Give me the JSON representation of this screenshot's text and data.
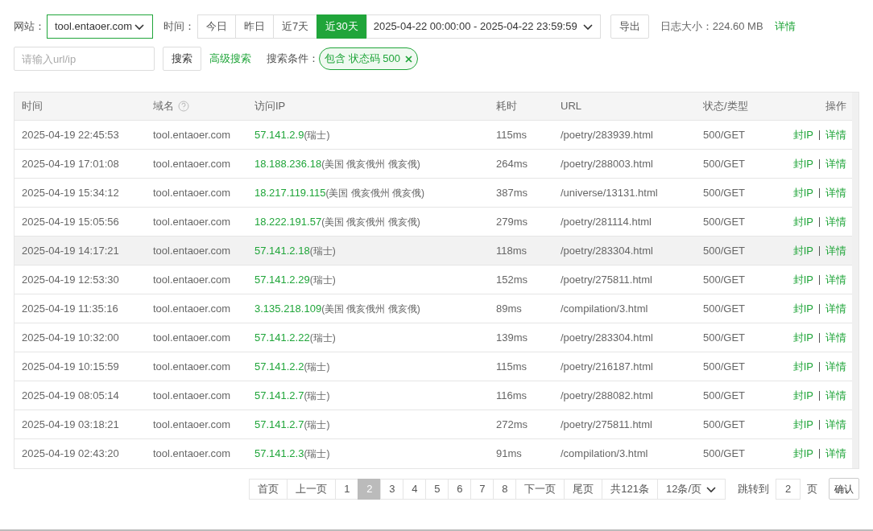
{
  "filters": {
    "site_label": "网站：",
    "site_value": "tool.entaoer.com",
    "time_label": "时间：",
    "ranges": [
      {
        "label": "今日",
        "selected": false
      },
      {
        "label": "昨日",
        "selected": false
      },
      {
        "label": "近7天",
        "selected": false
      },
      {
        "label": "近30天",
        "selected": true
      }
    ],
    "date_range": "2025-04-22 00:00:00 - 2025-04-22 23:59:59",
    "export": "导出",
    "log_size": "日志大小：224.60 MB",
    "details_link": "详情"
  },
  "search": {
    "placeholder": "请输入url/ip",
    "button": "搜索",
    "advanced": "高级搜索",
    "conditions_label": "搜索条件：",
    "tags": [
      "包含 状态码 500"
    ]
  },
  "table": {
    "columns": [
      "时间",
      "域名",
      "访问IP",
      "耗时",
      "URL",
      "状态/类型",
      "操作"
    ],
    "rows": [
      {
        "time": "2025-04-19 22:45:53",
        "domain": "tool.entaoer.com",
        "ip": "57.141.2.9",
        "location": "(瑞士)",
        "duration": "115ms",
        "url": "/poetry/283939.html",
        "status": "500/GET",
        "actions": [
          "封IP",
          "详情"
        ],
        "selected": false
      },
      {
        "time": "2025-04-19 17:01:08",
        "domain": "tool.entaoer.com",
        "ip": "18.188.236.18",
        "location": "(美国 俄亥俄州 俄亥俄)",
        "duration": "264ms",
        "url": "/poetry/288003.html",
        "status": "500/GET",
        "actions": [
          "封IP",
          "详情"
        ],
        "selected": false
      },
      {
        "time": "2025-04-19 15:34:12",
        "domain": "tool.entaoer.com",
        "ip": "18.217.119.115",
        "location": "(美国 俄亥俄州 俄亥俄)",
        "duration": "387ms",
        "url": "/universe/13131.html",
        "status": "500/GET",
        "actions": [
          "封IP",
          "详情"
        ],
        "selected": false
      },
      {
        "time": "2025-04-19 15:05:56",
        "domain": "tool.entaoer.com",
        "ip": "18.222.191.57",
        "location": "(美国 俄亥俄州 俄亥俄)",
        "duration": "279ms",
        "url": "/poetry/281114.html",
        "status": "500/GET",
        "actions": [
          "封IP",
          "详情"
        ],
        "selected": false
      },
      {
        "time": "2025-04-19 14:17:21",
        "domain": "tool.entaoer.com",
        "ip": "57.141.2.18",
        "location": "(瑞士)",
        "duration": "118ms",
        "url": "/poetry/283304.html",
        "status": "500/GET",
        "actions": [
          "封IP",
          "详情"
        ],
        "selected": true
      },
      {
        "time": "2025-04-19 12:53:30",
        "domain": "tool.entaoer.com",
        "ip": "57.141.2.29",
        "location": "(瑞士)",
        "duration": "152ms",
        "url": "/poetry/275811.html",
        "status": "500/GET",
        "actions": [
          "封IP",
          "详情"
        ],
        "selected": false
      },
      {
        "time": "2025-04-19 11:35:16",
        "domain": "tool.entaoer.com",
        "ip": "3.135.218.109",
        "location": "(美国 俄亥俄州 俄亥俄)",
        "duration": "89ms",
        "url": "/compilation/3.html",
        "status": "500/GET",
        "actions": [
          "封IP",
          "详情"
        ],
        "selected": false
      },
      {
        "time": "2025-04-19 10:32:00",
        "domain": "tool.entaoer.com",
        "ip": "57.141.2.22",
        "location": "(瑞士)",
        "duration": "139ms",
        "url": "/poetry/283304.html",
        "status": "500/GET",
        "actions": [
          "封IP",
          "详情"
        ],
        "selected": false
      },
      {
        "time": "2025-04-19 10:15:59",
        "domain": "tool.entaoer.com",
        "ip": "57.141.2.2",
        "location": "(瑞士)",
        "duration": "115ms",
        "url": "/poetry/216187.html",
        "status": "500/GET",
        "actions": [
          "封IP",
          "详情"
        ],
        "selected": false
      },
      {
        "time": "2025-04-19 08:05:14",
        "domain": "tool.entaoer.com",
        "ip": "57.141.2.7",
        "location": "(瑞士)",
        "duration": "116ms",
        "url": "/poetry/288082.html",
        "status": "500/GET",
        "actions": [
          "封IP",
          "详情"
        ],
        "selected": false
      },
      {
        "time": "2025-04-19 03:18:21",
        "domain": "tool.entaoer.com",
        "ip": "57.141.2.7",
        "location": "(瑞士)",
        "duration": "272ms",
        "url": "/poetry/275811.html",
        "status": "500/GET",
        "actions": [
          "封IP",
          "详情"
        ],
        "selected": false
      },
      {
        "time": "2025-04-19 02:43:20",
        "domain": "tool.entaoer.com",
        "ip": "57.141.2.3",
        "location": "(瑞士)",
        "duration": "91ms",
        "url": "/compilation/3.html",
        "status": "500/GET",
        "actions": [
          "封IP",
          "详情"
        ],
        "selected": false
      }
    ]
  },
  "pagination": {
    "first": "首页",
    "prev": "上一页",
    "pages": [
      {
        "label": "1",
        "selected": false
      },
      {
        "label": "2",
        "selected": true
      },
      {
        "label": "3",
        "selected": false
      },
      {
        "label": "4",
        "selected": false
      },
      {
        "label": "5",
        "selected": false
      },
      {
        "label": "6",
        "selected": false
      },
      {
        "label": "7",
        "selected": false
      },
      {
        "label": "8",
        "selected": false
      }
    ],
    "next": "下一页",
    "last": "尾页",
    "total": "共121条",
    "page_size": "12条/页",
    "jump_label": "跳转到",
    "jump_value": "2",
    "page_unit": "页",
    "confirm": "确认"
  }
}
